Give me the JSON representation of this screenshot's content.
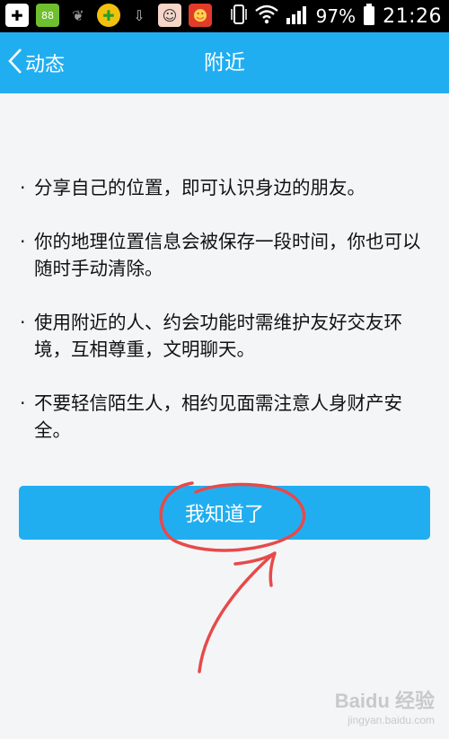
{
  "status_bar": {
    "battery_percent": "97%",
    "time": "21:26",
    "icons": [
      "plus-icon",
      "battery-widget-icon",
      "leaf-icon",
      "cross-app-icon",
      "download-icon",
      "avatar-girl-icon",
      "avatar-red-icon",
      "vibrate-icon",
      "wifi-icon",
      "signal-icon",
      "battery-icon"
    ]
  },
  "nav": {
    "back_label": "动态",
    "title": "附近"
  },
  "tips": [
    {
      "bullet": "·",
      "text": "分享自己的位置，即可认识身边的朋友。"
    },
    {
      "bullet": "·",
      "text": "你的地理位置信息会被保存一段时间，你也可以随时手动清除。"
    },
    {
      "bullet": "·",
      "text": "使用附近的人、约会功能时需维护友好交友环境，互相尊重，文明聊天。"
    },
    {
      "bullet": "·",
      "text": "不要轻信陌生人，相约见面需注意人身财产安全。"
    }
  ],
  "button": {
    "label": "我知道了"
  },
  "watermark": {
    "main": "Baidu 经验",
    "sub": "jingyan.baidu.com"
  },
  "colors": {
    "accent": "#21aef0",
    "annotation": "#e64a4a",
    "background": "#f4f5f7"
  }
}
